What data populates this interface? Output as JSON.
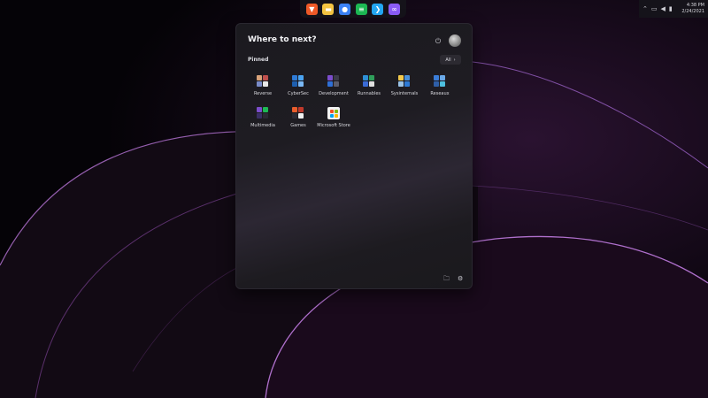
{
  "taskbar": {
    "apps": [
      {
        "name": "brave-icon",
        "glyph": "▼",
        "color": "#f05a28"
      },
      {
        "name": "file-explorer-icon",
        "glyph": "▬",
        "color": "#f4c542"
      },
      {
        "name": "messenger-icon",
        "glyph": "●",
        "color": "#3b82f6"
      },
      {
        "name": "spotify-icon",
        "glyph": "≡",
        "color": "#1db954"
      },
      {
        "name": "vscode-icon",
        "glyph": "❯",
        "color": "#23a7f2"
      },
      {
        "name": "visual-studio-icon",
        "glyph": "∞",
        "color": "#8b5cf6"
      }
    ]
  },
  "tray": {
    "icons": [
      "chevron-up-icon",
      "tablet-icon",
      "speaker-icon",
      "battery-icon"
    ],
    "time": "4:38 PM",
    "date": "2/24/2021"
  },
  "start_menu": {
    "title": "Where to next?",
    "pinned_label": "Pinned",
    "all_label": "All",
    "pinned": [
      {
        "label": "Reverse",
        "colors": [
          "#d9a37a",
          "#c0504d",
          "#7a8cc9",
          "#e8e8e8"
        ]
      },
      {
        "label": "CyberSec",
        "colors": [
          "#2e7bd6",
          "#4aa3f0",
          "#1d5fb0",
          "#7ab8f5"
        ]
      },
      {
        "label": "Development",
        "colors": [
          "#7c4dcc",
          "#3b3b48",
          "#2f6fd6",
          "#5c5c6a"
        ]
      },
      {
        "label": "Runnables",
        "colors": [
          "#2e8fd6",
          "#2f9e5a",
          "#3a6bd6",
          "#e0e0e0"
        ]
      },
      {
        "label": "Sysinternals",
        "colors": [
          "#f2c94c",
          "#4a90d9",
          "#9bc3e6",
          "#2d7ad6"
        ]
      },
      {
        "label": "Reseaux",
        "colors": [
          "#3b7dd8",
          "#6aa9e8",
          "#2f5fa8",
          "#4ec0e0"
        ]
      },
      {
        "label": "Multimedia",
        "colors": [
          "#7c4dcc",
          "#1db954",
          "#3b2f66",
          "#2b2b35"
        ]
      },
      {
        "label": "Games",
        "colors": [
          "#e85d2c",
          "#c0392b",
          "#2b2b35",
          "#f0f0f0"
        ]
      },
      {
        "label": "Microsoft Store",
        "colors": [
          "#f25022",
          "#7fba00",
          "#00a4ef",
          "#ffb900"
        ]
      }
    ]
  }
}
